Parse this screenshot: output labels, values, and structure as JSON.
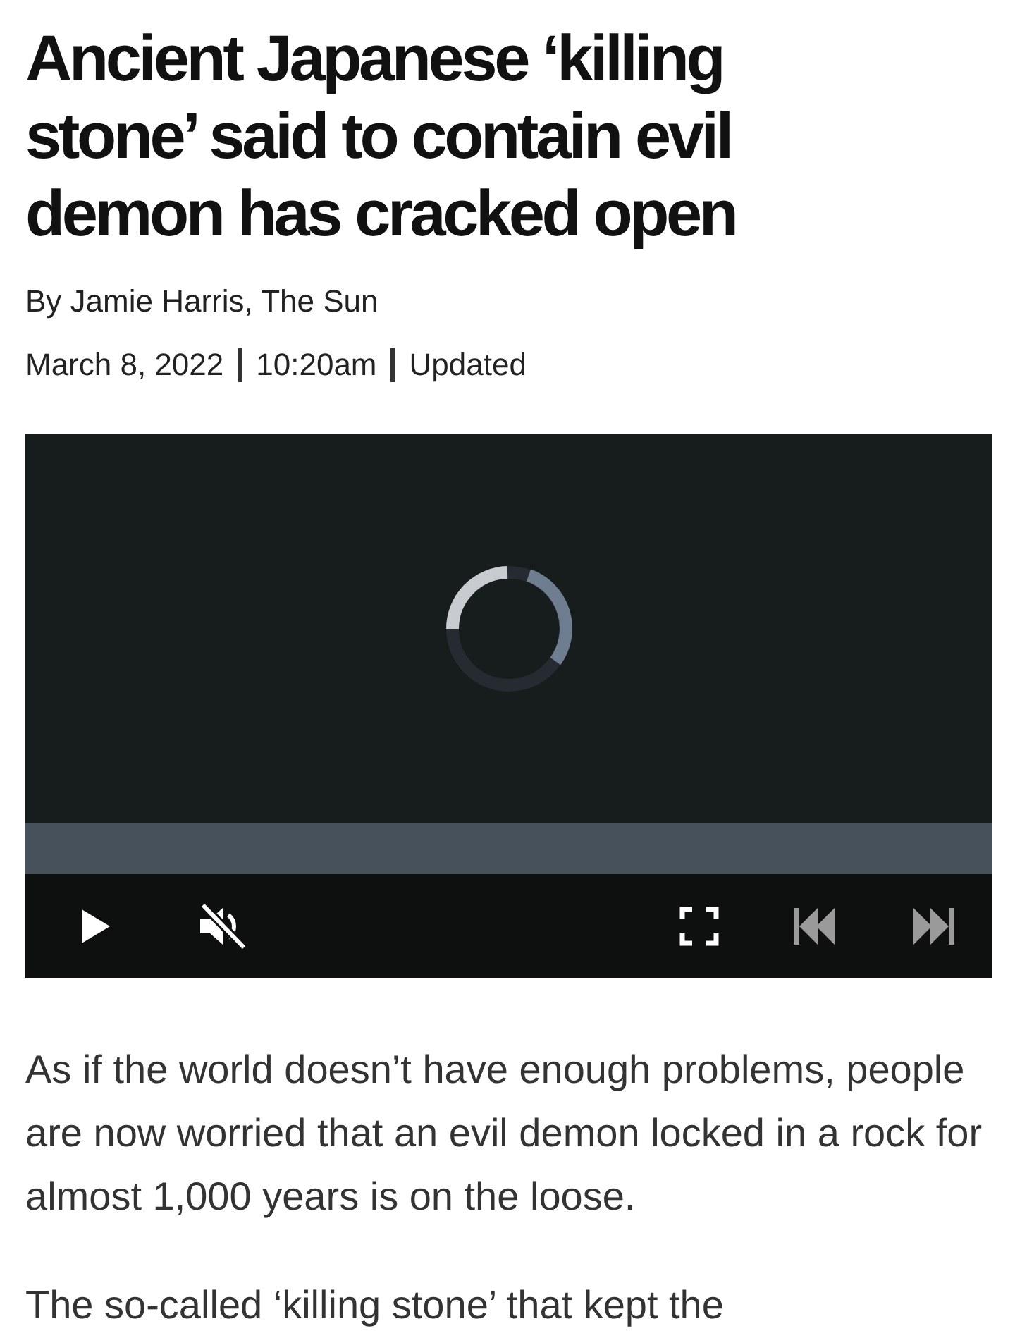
{
  "headline": "Ancient Japanese ‘killing stone’ said to contain evil demon has cracked open",
  "byline": "By Jamie Harris, The Sun",
  "meta": [
    "March 8, 2022",
    "10:20am",
    "Updated"
  ],
  "video": {
    "loading": true,
    "muted": true,
    "controls": [
      {
        "kind": "play",
        "disabled": false
      },
      {
        "kind": "mute",
        "disabled": false
      },
      {
        "kind": "fullscreen",
        "disabled": false
      },
      {
        "kind": "previous",
        "disabled": true
      },
      {
        "kind": "next",
        "disabled": true
      }
    ]
  },
  "paragraphs": [
    "As if the world doesn’t have enough problems, people are now worried that an evil demon locked in a rock for almost 1,000 years is on the loose.",
    "The so-called ‘killing stone’ that kept the"
  ]
}
